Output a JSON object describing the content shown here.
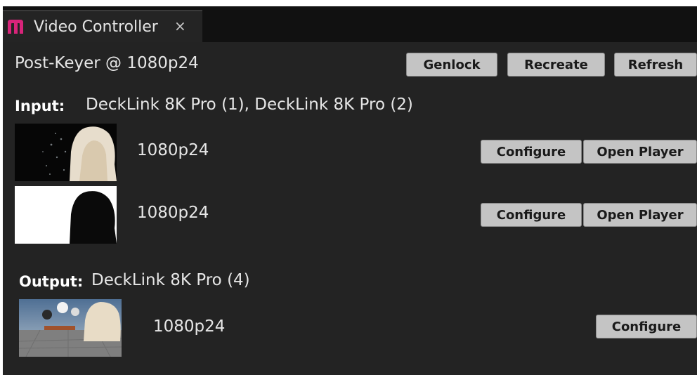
{
  "tab": {
    "title": "Video Controller",
    "close_glyph": "×",
    "logo_icon": "m-logo-icon"
  },
  "header": {
    "device": "Post-Keyer @ 1080p24",
    "buttons": {
      "genlock": "Genlock",
      "recreate": "Recreate",
      "refresh": "Refresh"
    }
  },
  "input": {
    "label": "Input:",
    "devices": "DeckLink 8K Pro (1), DeckLink 8K Pro (2)",
    "streams": [
      {
        "format": "1080p24",
        "configure": "Configure",
        "open_player": "Open Player"
      },
      {
        "format": "1080p24",
        "configure": "Configure",
        "open_player": "Open Player"
      }
    ]
  },
  "output": {
    "label": "Output:",
    "devices": "DeckLink 8K Pro (4)",
    "streams": [
      {
        "format": "1080p24",
        "configure": "Configure"
      }
    ]
  },
  "colors": {
    "brand": "#d8247a",
    "background": "#232323",
    "button": "#c4c4c4"
  }
}
